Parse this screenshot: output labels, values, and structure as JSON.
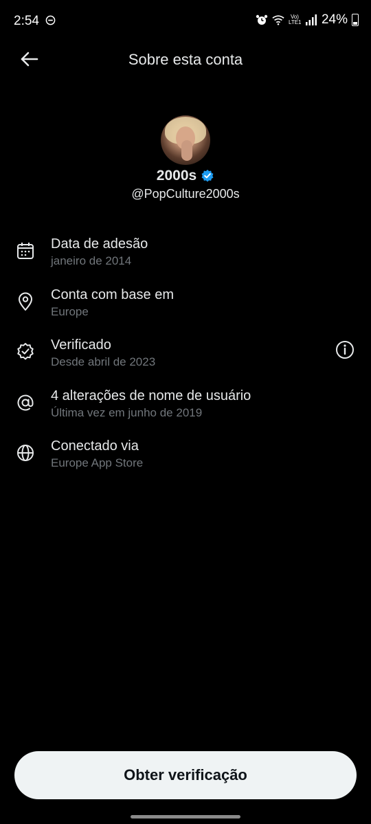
{
  "status_bar": {
    "time": "2:54",
    "volte_label": "Vo) LTE1",
    "battery_pct": "24%",
    "battery_level": 0.24
  },
  "header": {
    "title": "Sobre esta conta"
  },
  "profile": {
    "display_name": "2000s",
    "handle": "@PopCulture2000s",
    "verified": true,
    "badge_color": "#1d9bf0"
  },
  "info_items": [
    {
      "icon": "calendar-icon",
      "title": "Data de adesão",
      "subtitle": "janeiro de 2014"
    },
    {
      "icon": "location-pin-icon",
      "title": "Conta com base em",
      "subtitle": "Europe"
    },
    {
      "icon": "verified-outline-icon",
      "title": "Verificado",
      "subtitle": "Desde abril de 2023",
      "action_icon": "info-icon"
    },
    {
      "icon": "at-sign-icon",
      "title": "4 alterações de nome de usuário",
      "subtitle": "Última vez em junho de 2019"
    },
    {
      "icon": "globe-icon",
      "title": "Conectado via",
      "subtitle": "Europe App Store"
    }
  ],
  "cta": {
    "label": "Obter verificação"
  },
  "colors": {
    "background": "#000000",
    "text_primary": "#e7e9ea",
    "text_secondary": "#71767b",
    "button_bg": "#eff3f4",
    "button_text": "#0f1419"
  }
}
